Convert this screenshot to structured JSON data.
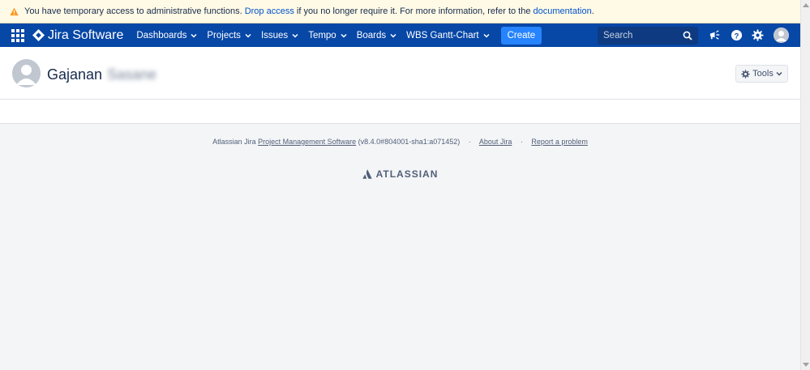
{
  "banner": {
    "text_before": "You have temporary access to administrative functions. ",
    "link_drop": "Drop access",
    "text_middle": " if you no longer require it. For more information, refer to the ",
    "link_docs": "documentation",
    "text_after": "."
  },
  "header": {
    "logo_text": "Jira Software",
    "nav": [
      "Dashboards",
      "Projects",
      "Issues",
      "Tempo",
      "Boards",
      "WBS Gantt-Chart"
    ],
    "create_label": "Create",
    "search_placeholder": "Search"
  },
  "profile": {
    "first_name": "Gajanan",
    "last_name": "Sasane",
    "tools_label": "Tools"
  },
  "footer": {
    "prefix": "Atlassian Jira ",
    "pm_link": "Project Management Software",
    "version": " (v8.4.0#804001-sha1:a071452)",
    "about": "About Jira",
    "report": "Report a problem",
    "separator": "·",
    "brand": "ATLASSIAN"
  },
  "colors": {
    "header_bg": "#0747a6",
    "create_bg": "#2684ff",
    "banner_bg": "#fffae6",
    "warning": "#ff991f"
  }
}
